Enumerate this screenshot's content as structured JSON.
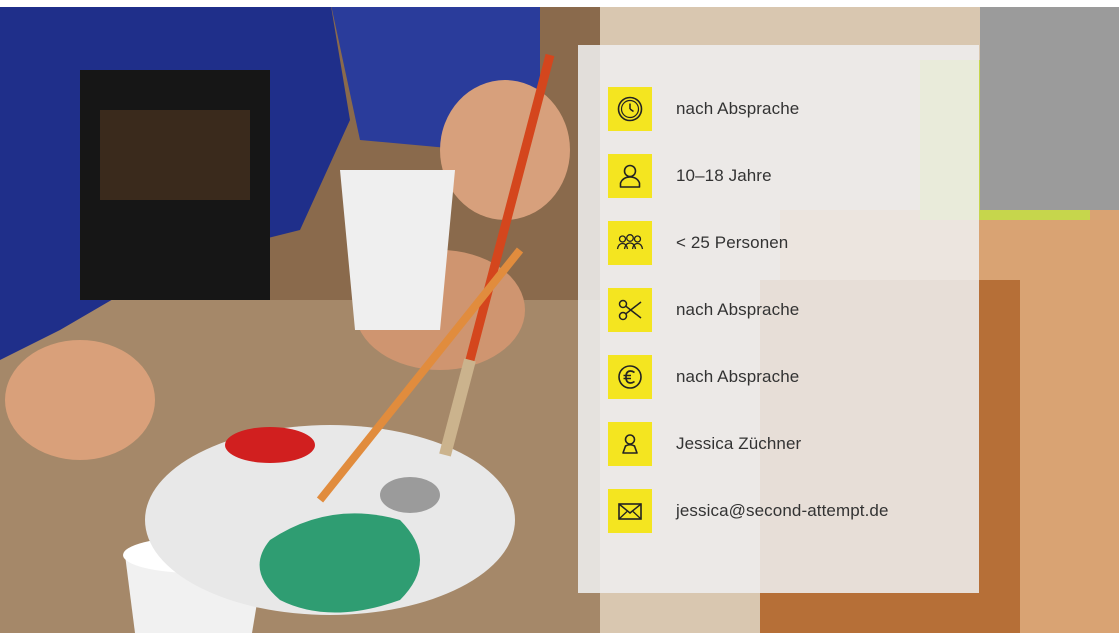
{
  "accent_color": "#f4e520",
  "panel_color": "#eeeeee",
  "text_color": "#333333",
  "info_items": [
    {
      "icon": "clock-icon",
      "text": "nach Absprache"
    },
    {
      "icon": "person-icon",
      "text": "10–18 Jahre"
    },
    {
      "icon": "group-icon",
      "text": "< 25 Personen"
    },
    {
      "icon": "scissors-icon",
      "text": "nach Absprache"
    },
    {
      "icon": "euro-icon",
      "text": "nach Absprache"
    },
    {
      "icon": "contact-person-icon",
      "text": " Jessica Züchner"
    },
    {
      "icon": "envelope-icon",
      "text": "jessica@second-attempt.de"
    }
  ]
}
